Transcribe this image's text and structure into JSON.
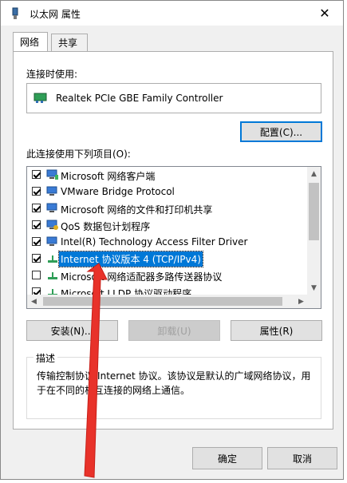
{
  "window": {
    "title": "以太网 属性",
    "close_glyph": "✕"
  },
  "tabs": [
    {
      "label": "网络",
      "active": true
    },
    {
      "label": "共享",
      "active": false
    }
  ],
  "connect_using_label": "连接时使用:",
  "adapter": {
    "name": "Realtek PCIe GBE Family Controller"
  },
  "configure_button": "配置(C)...",
  "items_label": "此连接使用下列项目(O):",
  "items": [
    {
      "label": "Microsoft 网络客户端",
      "checked": true
    },
    {
      "label": "VMware Bridge Protocol",
      "checked": true
    },
    {
      "label": "Microsoft 网络的文件和打印机共享",
      "checked": true
    },
    {
      "label": "QoS 数据包计划程序",
      "checked": true
    },
    {
      "label": "Intel(R) Technology Access Filter Driver",
      "checked": true
    },
    {
      "label": "Internet 协议版本 4 (TCP/IPv4)",
      "checked": true,
      "selected": true
    },
    {
      "label": "Microsoft 网络适配器多路传送器协议",
      "checked": false
    },
    {
      "label": "Microsoft LLDP 协议驱动程序",
      "checked": true
    }
  ],
  "buttons": {
    "install": "安装(N)...",
    "uninstall": "卸载(U)",
    "properties": "属性(R)"
  },
  "description": {
    "legend": "描述",
    "text": "传输控制协议/Internet 协议。该协议是默认的广域网络协议，用于在不同的相互连接的网络上通信。"
  },
  "footer": {
    "ok": "确定",
    "cancel": "取消"
  },
  "colors": {
    "accent": "#0078d7",
    "annotation_arrow": "#e8322a"
  }
}
